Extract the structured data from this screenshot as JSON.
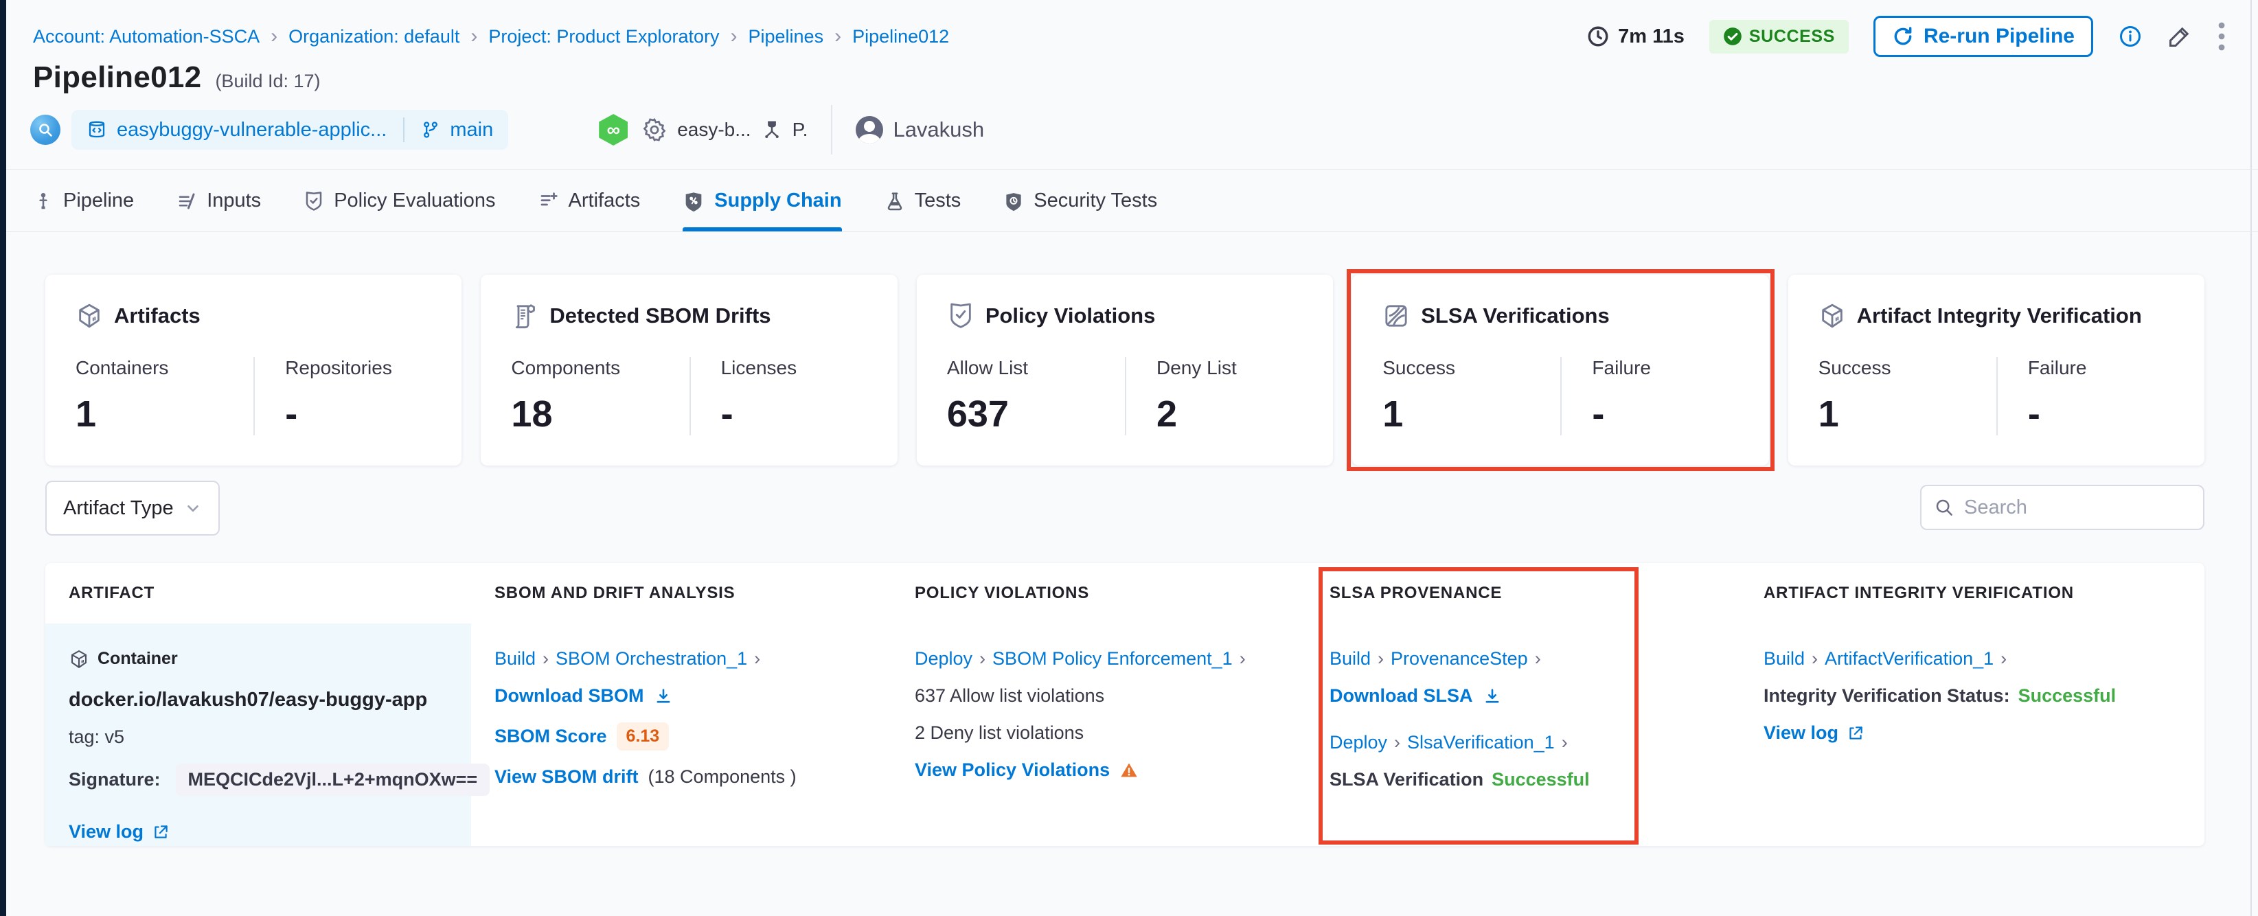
{
  "breadcrumb": {
    "items": [
      "Account: Automation-SSCA",
      "Organization: default",
      "Project: Product Exploratory",
      "Pipelines",
      "Pipeline012"
    ]
  },
  "header": {
    "duration": "7m 11s",
    "status": "SUCCESS",
    "rerun_label": "Re-run Pipeline",
    "title": "Pipeline012",
    "build_id": "(Build Id: 17)",
    "repo_name": "easybuggy-vulnerable-applic...",
    "branch": "main",
    "trigger_name": "easy-b...",
    "trigger_abbrev": "P.",
    "user": "Lavakush",
    "webhook_glyph": "∞"
  },
  "tabs": [
    {
      "label": "Pipeline",
      "active": false
    },
    {
      "label": "Inputs",
      "active": false
    },
    {
      "label": "Policy Evaluations",
      "active": false
    },
    {
      "label": "Artifacts",
      "active": false
    },
    {
      "label": "Supply Chain",
      "active": true
    },
    {
      "label": "Tests",
      "active": false
    },
    {
      "label": "Security Tests",
      "active": false
    }
  ],
  "cards": [
    {
      "title": "Artifacts",
      "stats": [
        {
          "label": "Containers",
          "value": "1"
        },
        {
          "label": "Repositories",
          "value": "-"
        }
      ]
    },
    {
      "title": "Detected SBOM Drifts",
      "stats": [
        {
          "label": "Components",
          "value": "18"
        },
        {
          "label": "Licenses",
          "value": "-"
        }
      ]
    },
    {
      "title": "Policy Violations",
      "stats": [
        {
          "label": "Allow List",
          "value": "637"
        },
        {
          "label": "Deny List",
          "value": "2"
        }
      ]
    },
    {
      "title": "SLSA Verifications",
      "highlighted": true,
      "stats": [
        {
          "label": "Success",
          "value": "1"
        },
        {
          "label": "Failure",
          "value": "-"
        }
      ]
    },
    {
      "title": "Artifact Integrity Verification",
      "stats": [
        {
          "label": "Success",
          "value": "1"
        },
        {
          "label": "Failure",
          "value": "-"
        }
      ]
    }
  ],
  "filters": {
    "artifact_type_label": "Artifact Type",
    "search_placeholder": "Search"
  },
  "table": {
    "columns": [
      "ARTIFACT",
      "SBOM AND DRIFT ANALYSIS",
      "POLICY VIOLATIONS",
      "SLSA PROVENANCE",
      "ARTIFACT INTEGRITY VERIFICATION"
    ],
    "row": {
      "artifact": {
        "type_badge": "Container",
        "name": "docker.io/lavakush07/easy-buggy-app",
        "tag": "tag: v5",
        "signature_label": "Signature:",
        "signature_value": "MEQCICde2Vjl...L+2+mqnOXw==",
        "view_log": "View log"
      },
      "sbom": {
        "stage": "Build",
        "step": "SBOM Orchestration_1",
        "download_label": "Download SBOM",
        "score_label": "SBOM Score",
        "score_value": "6.13",
        "drift_link": "View SBOM drift",
        "drift_suffix": "(18 Components )"
      },
      "policy": {
        "stage": "Deploy",
        "step": "SBOM Policy Enforcement_1",
        "allow_text": "637 Allow list violations",
        "deny_text": "2 Deny list violations",
        "view_link": "View Policy Violations"
      },
      "slsa": {
        "stage1": "Build",
        "step1": "ProvenanceStep",
        "download_label": "Download SLSA",
        "stage2": "Deploy",
        "step2": "SlsaVerification_1",
        "status_label": "SLSA Verification",
        "status_value": "Successful"
      },
      "integrity": {
        "stage": "Build",
        "step": "ArtifactVerification_1",
        "status_label": "Integrity Verification Status:",
        "status_value": "Successful",
        "view_log": "View log"
      }
    }
  },
  "colors": {
    "accent_blue": "#0278D5",
    "success_green": "#1B841D",
    "status_green_text": "#42AB45",
    "highlight_red": "#E8432C",
    "warning_orange": "#E8722C",
    "score_orange": "#DD5B10"
  }
}
